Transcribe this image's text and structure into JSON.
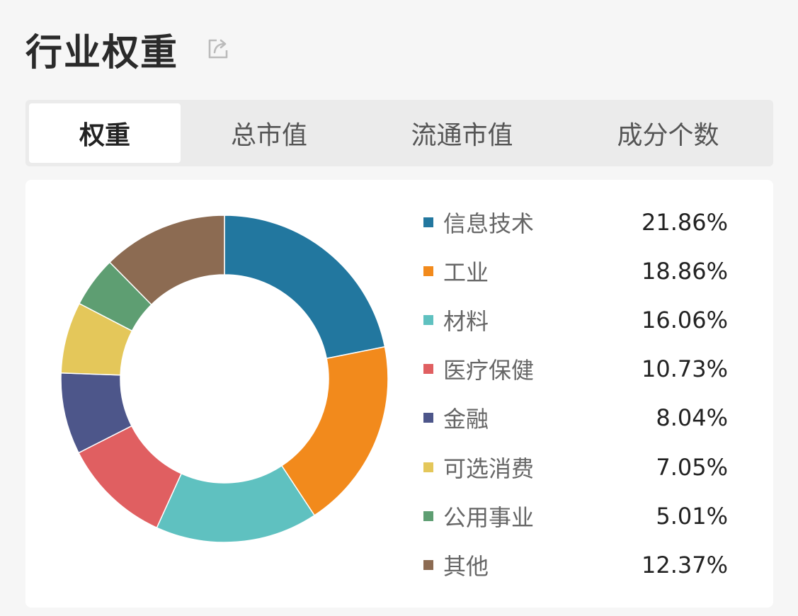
{
  "header": {
    "title": "行业权重",
    "share_icon": "share-icon"
  },
  "tabs": [
    {
      "label": "权重",
      "active": true
    },
    {
      "label": "总市值",
      "active": false
    },
    {
      "label": "流通市值",
      "active": false
    },
    {
      "label": "成分个数",
      "active": false
    }
  ],
  "chart_data": {
    "type": "pie",
    "donut": true,
    "title": "",
    "categories": [
      "信息技术",
      "工业",
      "材料",
      "医疗保健",
      "金融",
      "可选消费",
      "公用事业",
      "其他"
    ],
    "values": [
      21.86,
      18.86,
      16.06,
      10.73,
      8.04,
      7.05,
      5.01,
      12.37
    ],
    "value_labels": [
      "21.86%",
      "18.86%",
      "16.06%",
      "10.73%",
      "8.04%",
      "7.05%",
      "5.01%",
      "12.37%"
    ],
    "colors": [
      "#22779f",
      "#f28a1c",
      "#5fc1c0",
      "#e05f61",
      "#4d568a",
      "#e4c75a",
      "#5e9e72",
      "#8c6b52"
    ],
    "legend_position": "right"
  }
}
